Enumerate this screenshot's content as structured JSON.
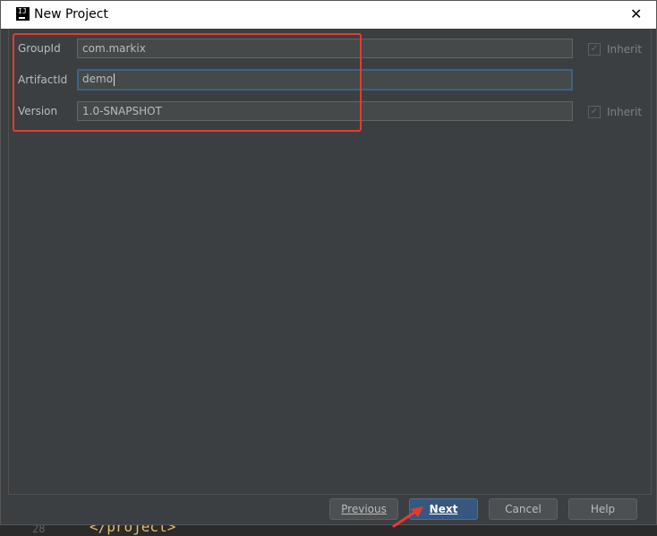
{
  "window": {
    "title": "New Project",
    "app_icon": "intellij-icon"
  },
  "form": {
    "group_id": {
      "label": "GroupId",
      "value": "com.markix",
      "inherit_label": "Inherit",
      "inherit_checked": true
    },
    "artifact_id": {
      "label": "ArtifactId",
      "value": "demo"
    },
    "version": {
      "label": "Version",
      "value": "1.0-SNAPSHOT",
      "inherit_label": "Inherit",
      "inherit_checked": true
    }
  },
  "buttons": {
    "previous": "Previous",
    "next": "Next",
    "cancel": "Cancel",
    "help": "Help"
  },
  "background_editor": {
    "line_number": "28",
    "code": "</project>"
  },
  "colors": {
    "annotation": "#e53b2f",
    "primary_button": "#365880",
    "dialog_bg": "#3c3f41"
  }
}
